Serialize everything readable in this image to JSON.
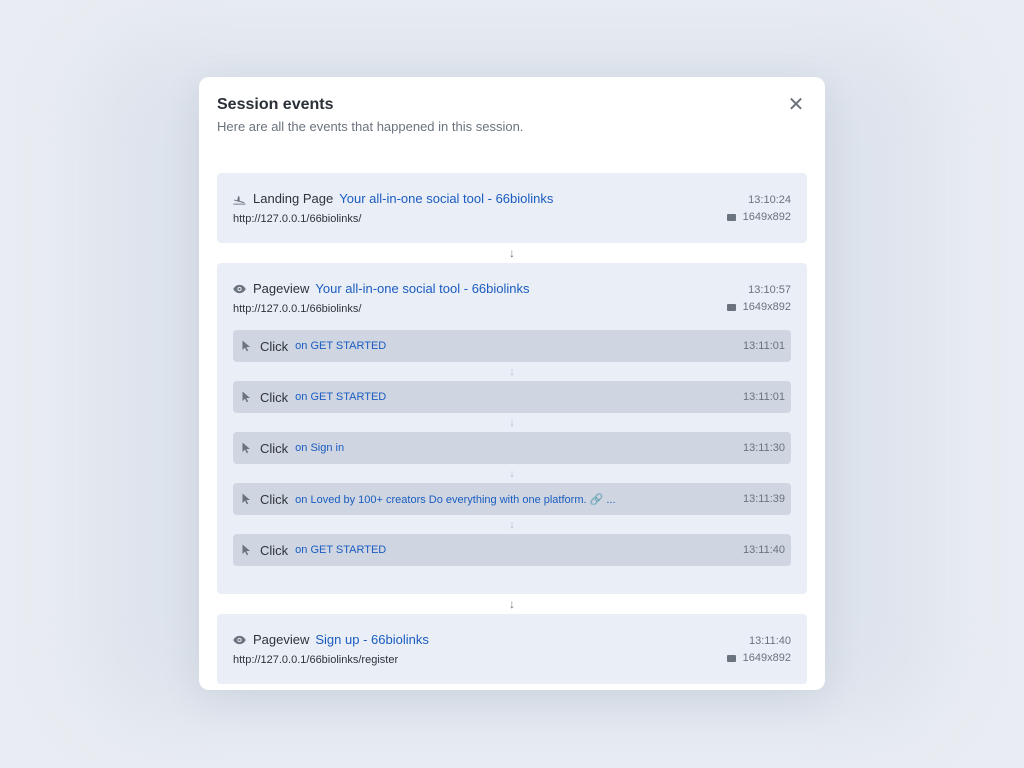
{
  "modal": {
    "title": "Session events",
    "subtitle": "Here are all the events that happened in this session.",
    "close_symbol": "✕"
  },
  "events": [
    {
      "icon": "plane-landing-icon",
      "type": "Landing Page",
      "title": "Your all-in-one social tool - 66biolinks",
      "url": "http://127.0.0.1/66biolinks/",
      "time": "13:10:24",
      "resolution": "1649x892"
    },
    {
      "icon": "eye-icon",
      "type": "Pageview",
      "title": "Your all-in-one social tool - 66biolinks",
      "url": "http://127.0.0.1/66biolinks/",
      "time": "13:10:57",
      "resolution": "1649x892",
      "clicks": [
        {
          "label": "Click",
          "target": "on GET STARTED",
          "time": "13:11:01"
        },
        {
          "label": "Click",
          "target": "on GET STARTED",
          "time": "13:11:01"
        },
        {
          "label": "Click",
          "target": "on Sign in",
          "time": "13:11:30"
        },
        {
          "label": "Click",
          "target": "on Loved by 100+ creators Do everything with one platform. 🔗 ...",
          "time": "13:11:39"
        },
        {
          "label": "Click",
          "target": "on GET STARTED",
          "time": "13:11:40"
        }
      ]
    },
    {
      "icon": "eye-icon",
      "type": "Pageview",
      "title": "Sign up - 66biolinks",
      "url": "http://127.0.0.1/66biolinks/register",
      "time": "13:11:40",
      "resolution": "1649x892"
    }
  ],
  "connector_symbol": "↓",
  "colors": {
    "accent": "#1b5cc0",
    "event_bg": "#e9eef7",
    "click_bg": "#cfd6e1"
  }
}
